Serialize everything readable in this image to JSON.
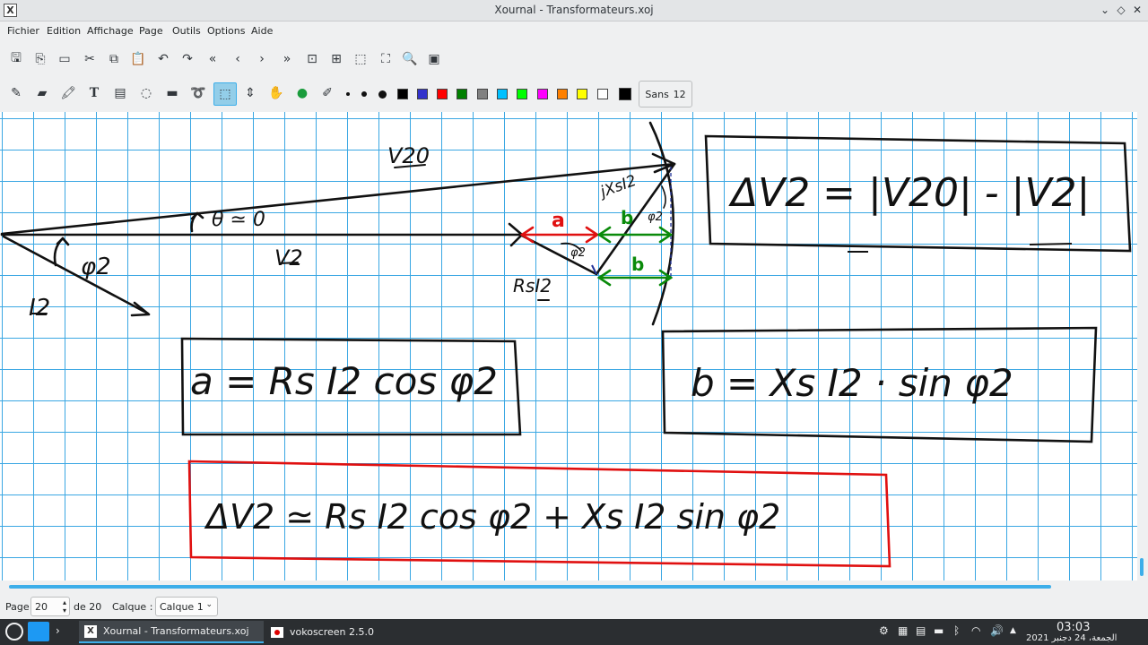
{
  "window": {
    "title": "Xournal - Transformateurs.xoj",
    "app_icon": "X"
  },
  "menu": [
    "Fichier",
    "Edition",
    "Affichage",
    "Page",
    "Outils",
    "Options",
    "Aide"
  ],
  "toolbar1": {
    "icons": [
      "save-icon",
      "export-pdf-icon",
      "open-icon",
      "cut-icon",
      "copy-icon",
      "paste-icon",
      "undo-icon",
      "redo-icon",
      "first-page-icon",
      "previous-page-icon",
      "next-page-icon",
      "last-page-icon",
      "zoom-fit-icon",
      "zoom-100-icon",
      "zoom-width-icon",
      "zoom-height-icon",
      "zoom-icon",
      "fullscreen-icon"
    ]
  },
  "toolbar2": {
    "tools": [
      "pen-icon",
      "eraser-icon",
      "highlighter-icon",
      "text-icon",
      "image-icon",
      "shape-recognizer-icon",
      "ruler-icon",
      "lasso-icon",
      "rect-select-icon",
      "vertical-space-icon",
      "hand-icon",
      "default-tool-icon",
      "default-pen-icon"
    ],
    "colors": [
      "#000000",
      "#3333cc",
      "#ff0000",
      "#008000",
      "#808080",
      "#00c0ff",
      "#00ff00",
      "#ff00ff",
      "#ff8000",
      "#ffff00",
      "#ffffff"
    ],
    "font_name": "Sans",
    "font_size": "12"
  },
  "drawing": {
    "labels": {
      "V20_top": "V20",
      "theta": "θ ≃ 0",
      "V2": "V2",
      "phi2": "φ2",
      "I2": "I2",
      "a": "a",
      "b1": "b",
      "b2": "b",
      "jXsI2": "jXsI2",
      "RsI2": "RsI2",
      "phi2_small": "φ2",
      "phi2_right": "φ2"
    },
    "boxes": {
      "deltaV2_def": "ΔV2 = |V20| - |V2|",
      "a_formula": "a = Rs I2 cos φ2",
      "b_formula": "b = Xs I2 · sin φ2",
      "result": "ΔV2 ≃ Rs I2 cos φ2 + Xs I2 sin φ2"
    }
  },
  "status": {
    "page_label": "Page",
    "page_value": "20",
    "of_label": "de 20",
    "layer_label": "Calque :",
    "layer_value": "Calque 1"
  },
  "taskbar": {
    "tasks": [
      "Xournal - Transformateurs.xoj",
      "vokoscreen 2.5.0"
    ],
    "time": "03:03",
    "date": "الجمعة، 24 دجنبر 2021"
  }
}
